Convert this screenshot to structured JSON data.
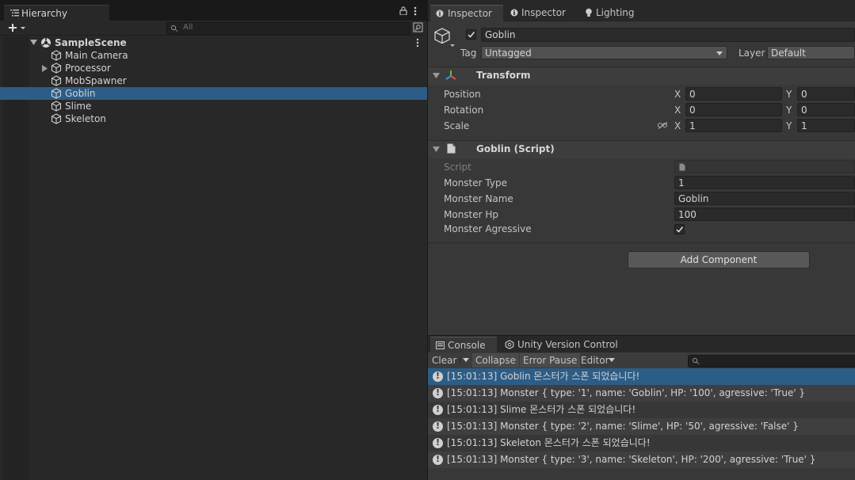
{
  "hierarchy": {
    "tab_label": "Hierarchy",
    "search_placeholder": "All",
    "scene_name": "SampleScene",
    "items": [
      {
        "label": "Main Camera",
        "expandable": false,
        "selected": false
      },
      {
        "label": "Processor",
        "expandable": true,
        "selected": false
      },
      {
        "label": "MobSpawner",
        "expandable": false,
        "selected": false
      },
      {
        "label": "Goblin",
        "expandable": false,
        "selected": true
      },
      {
        "label": "Slime",
        "expandable": false,
        "selected": false
      },
      {
        "label": "Skeleton",
        "expandable": false,
        "selected": false
      }
    ]
  },
  "inspector": {
    "tabs": [
      {
        "label": "Inspector",
        "icon": "info-icon",
        "active": true
      },
      {
        "label": "Inspector",
        "icon": "info-icon",
        "active": false
      },
      {
        "label": "Lighting",
        "icon": "lightbulb-icon",
        "active": false
      }
    ],
    "object": {
      "active": true,
      "name": "Goblin",
      "tag_label": "Tag",
      "tag_value": "Untagged",
      "layer_label": "Layer",
      "layer_value": "Default"
    },
    "transform": {
      "title": "Transform",
      "position": {
        "label": "Position",
        "x": "0",
        "y": "0"
      },
      "rotation": {
        "label": "Rotation",
        "x": "0",
        "y": "0"
      },
      "scale": {
        "label": "Scale",
        "x": "1",
        "y": "1"
      },
      "axis_x": "X",
      "axis_y": "Y"
    },
    "script_component": {
      "title": "Goblin (Script)",
      "script_label": "Script",
      "monster_type": {
        "label": "Monster Type",
        "value": "1"
      },
      "monster_name": {
        "label": "Monster Name",
        "value": "Goblin"
      },
      "monster_hp": {
        "label": "Monster Hp",
        "value": "100"
      },
      "monster_agressive": {
        "label": "Monster Agressive",
        "value": true
      }
    },
    "add_component_label": "Add Component"
  },
  "console": {
    "tabs": [
      {
        "label": "Console",
        "active": true
      },
      {
        "label": "Unity Version Control",
        "active": false
      }
    ],
    "toolbar": {
      "clear": "Clear",
      "collapse": "Collapse",
      "error_pause": "Error Pause",
      "editor": "Editor"
    },
    "logs": [
      "[15:01:13] Goblin 몬스터가 스폰 되었습니다!",
      "[15:01:13] Monster { type: '1', name: 'Goblin', HP: '100', agressive: 'True' }",
      "[15:01:13] Slime 몬스터가 스폰 되었습니다!",
      "[15:01:13] Monster { type: '2', name: 'Slime', HP: '50', agressive: 'False' }",
      "[15:01:13] Skeleton 몬스터가 스폰 되었습니다!",
      "[15:01:13] Monster { type: '3', name: 'Skeleton', HP: '200', agressive: 'True' }"
    ],
    "selected_log": 0
  },
  "colors": {
    "selection": "#2c5d87",
    "panel": "#383838",
    "hierarchy_bg": "#282828"
  }
}
